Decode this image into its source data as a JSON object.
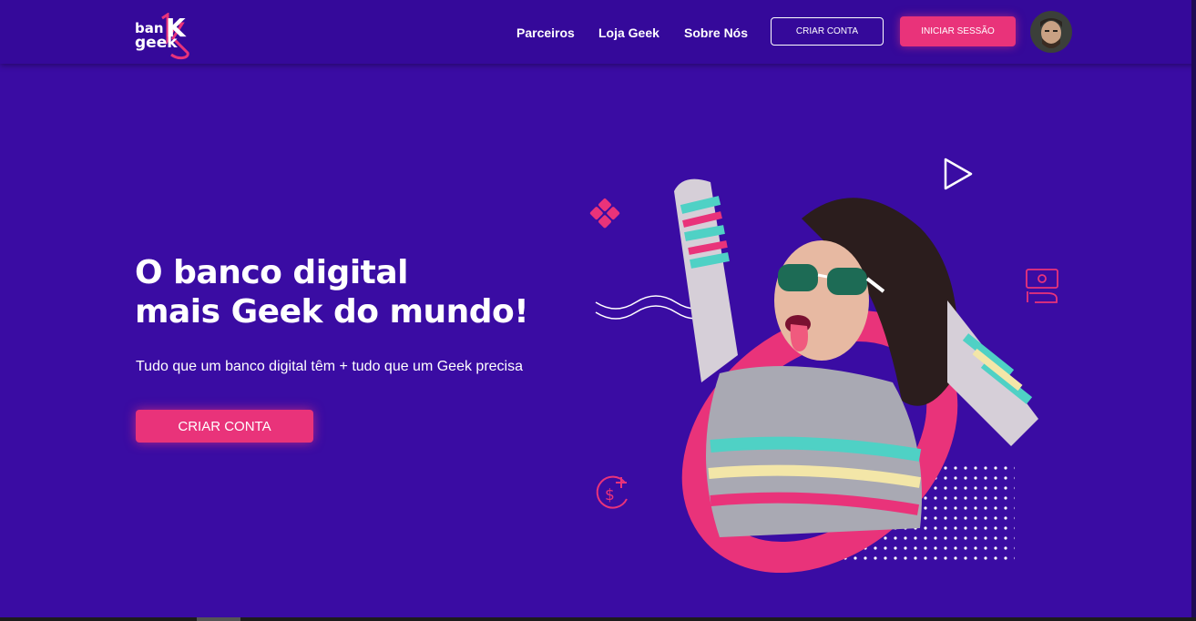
{
  "brand": {
    "logo_text_line1": "ban",
    "logo_text_line2": "geek",
    "logo_letter": "K"
  },
  "nav": {
    "links": [
      {
        "label": "Parceiros"
      },
      {
        "label": "Loja Geek"
      },
      {
        "label": "Sobre Nós"
      }
    ],
    "create_account_label": "CRIAR CONTA",
    "login_label": "INICIAR SESSÃO"
  },
  "hero": {
    "headline_line1": "O banco digital",
    "headline_line2": "mais Geek do mundo!",
    "subtitle": "Tudo que um banco digital têm + tudo que um Geek precisa",
    "cta_label": "CRIAR CONTA"
  },
  "icons": [
    "diamond-tiles-icon",
    "wave-lines-icon",
    "play-icon",
    "money-hand-icon",
    "dollar-plus-icon",
    "dot-grid-pattern"
  ],
  "colors": {
    "background": "#3a0ca3",
    "accent": "#e9337a",
    "text": "#ffffff"
  }
}
